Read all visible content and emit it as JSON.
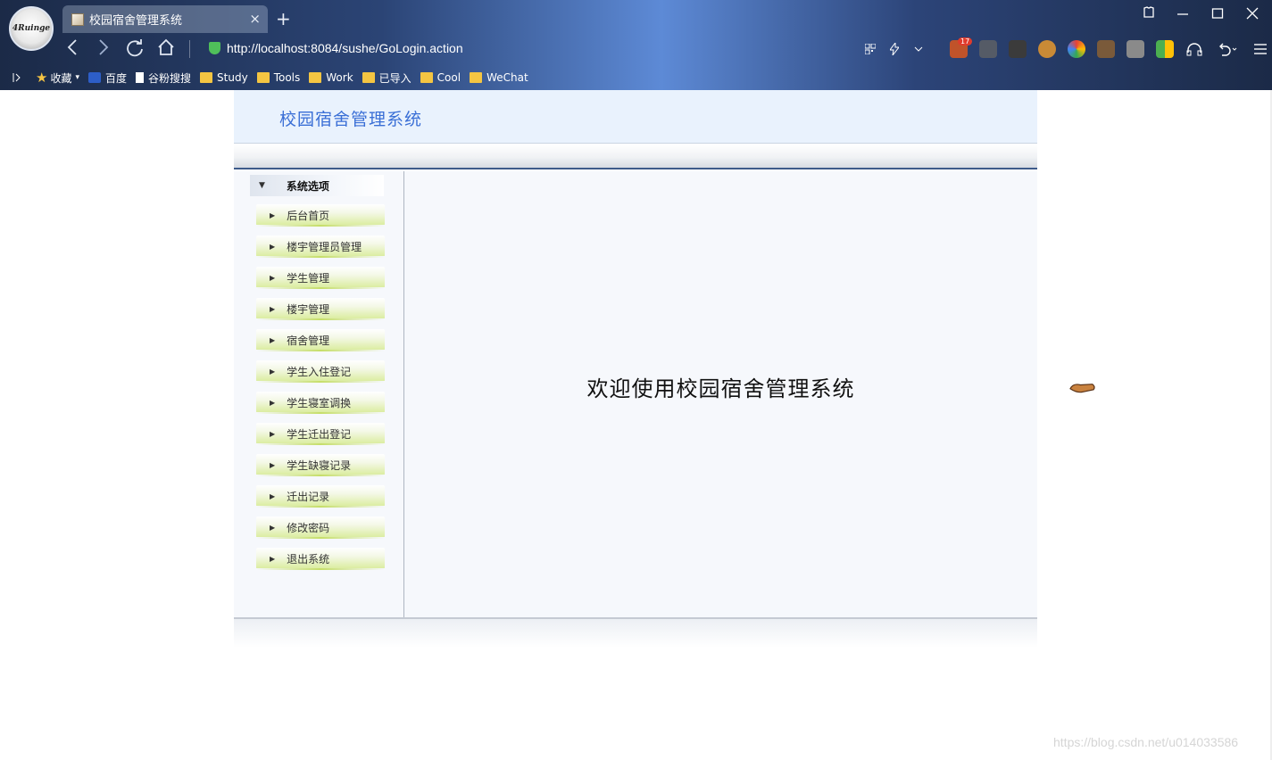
{
  "browser": {
    "tab_title": "校园宿舍管理系统",
    "tab_close": "×",
    "new_tab": "+",
    "url": "http://localhost:8084/sushe/GoLogin.action",
    "avatar_text": "4Ruinge",
    "extension_badge": "17",
    "bookmarks": [
      "收藏",
      "百度",
      "谷粉搜搜",
      "Study",
      "Tools",
      "Work",
      "已导入",
      "Cool",
      "WeChat"
    ]
  },
  "page": {
    "header_title": "校园宿舍管理系统",
    "sidebar_title": "系统选项",
    "menu": [
      "后台首页",
      "楼宇管理员管理",
      "学生管理",
      "楼宇管理",
      "宿舍管理",
      "学生入住登记",
      "学生寝室调换",
      "学生迁出登记",
      "学生缺寝记录",
      "迁出记录",
      "修改密码",
      "退出系统"
    ],
    "welcome_text": "欢迎使用校园宿舍管理系统"
  },
  "watermark": "https://blog.csdn.net/u014033586"
}
